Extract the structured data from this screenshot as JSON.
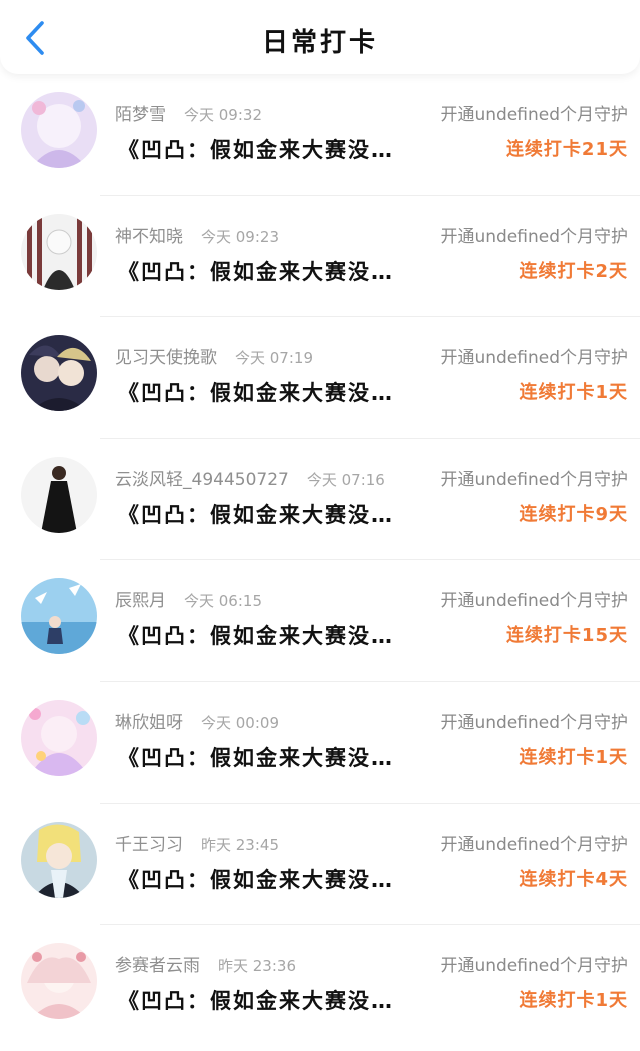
{
  "header": {
    "title": "日常打卡",
    "back_icon": "chevron-left-icon",
    "accent": "#2e8cf0"
  },
  "colors": {
    "streak": "#f07a36",
    "meta": "#8f8f8f"
  },
  "items": [
    {
      "name": "陌梦雪",
      "time": "今天 09:32",
      "vip": "开通undefined个月守护",
      "content": "《凹凸：假如金来大赛没…",
      "streak": "连续打卡21天"
    },
    {
      "name": "神不知晓",
      "time": "今天 09:23",
      "vip": "开通undefined个月守护",
      "content": "《凹凸：假如金来大赛没…",
      "streak": "连续打卡2天"
    },
    {
      "name": "见习天使挽歌",
      "time": "今天 07:19",
      "vip": "开通undefined个月守护",
      "content": "《凹凸：假如金来大赛没…",
      "streak": "连续打卡1天"
    },
    {
      "name": "云淡风轻_494450727",
      "time": "今天 07:16",
      "vip": "开通undefined个月守护",
      "content": "《凹凸：假如金来大赛没…",
      "streak": "连续打卡9天"
    },
    {
      "name": "辰熙月",
      "time": "今天 06:15",
      "vip": "开通undefined个月守护",
      "content": "《凹凸：假如金来大赛没…",
      "streak": "连续打卡15天"
    },
    {
      "name": "琳欣姐呀",
      "time": "今天 00:09",
      "vip": "开通undefined个月守护",
      "content": "《凹凸：假如金来大赛没…",
      "streak": "连续打卡1天"
    },
    {
      "name": "千王习习",
      "time": "昨天 23:45",
      "vip": "开通undefined个月守护",
      "content": "《凹凸：假如金来大赛没…",
      "streak": "连续打卡4天"
    },
    {
      "name": "参赛者云雨",
      "time": "昨天 23:36",
      "vip": "开通undefined个月守护",
      "content": "《凹凸：假如金来大赛没…",
      "streak": "连续打卡1天"
    }
  ]
}
